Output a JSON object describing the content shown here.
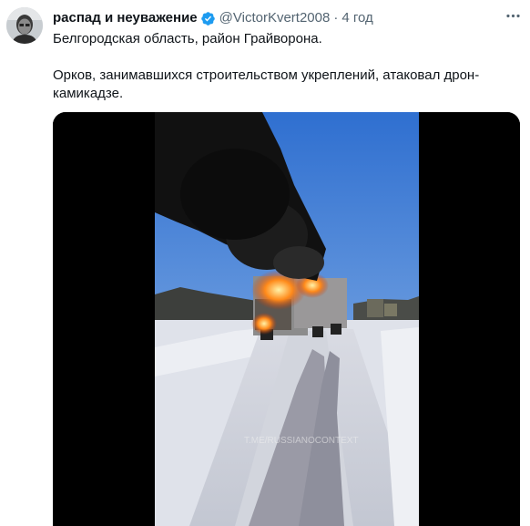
{
  "tweet": {
    "author": {
      "display_name": "распад и неуважение",
      "handle": "@VictorKvert2008",
      "verified": true
    },
    "separator": "·",
    "time": "4 год",
    "text_lines": [
      "Белгородская область, район  Грайворона.",
      "Орков, занимавшихся строительством укреплений, атаковал дрон-камикадзе."
    ],
    "media": {
      "watermark": "T.ME/RUSSIANOCONTEXT"
    },
    "icons": {
      "verified": "verified-badge-icon",
      "more": "more-horizontal-icon"
    },
    "colors": {
      "verified": "#1d9bf0",
      "secondary_text": "#536471",
      "primary_text": "#0f1419"
    }
  }
}
